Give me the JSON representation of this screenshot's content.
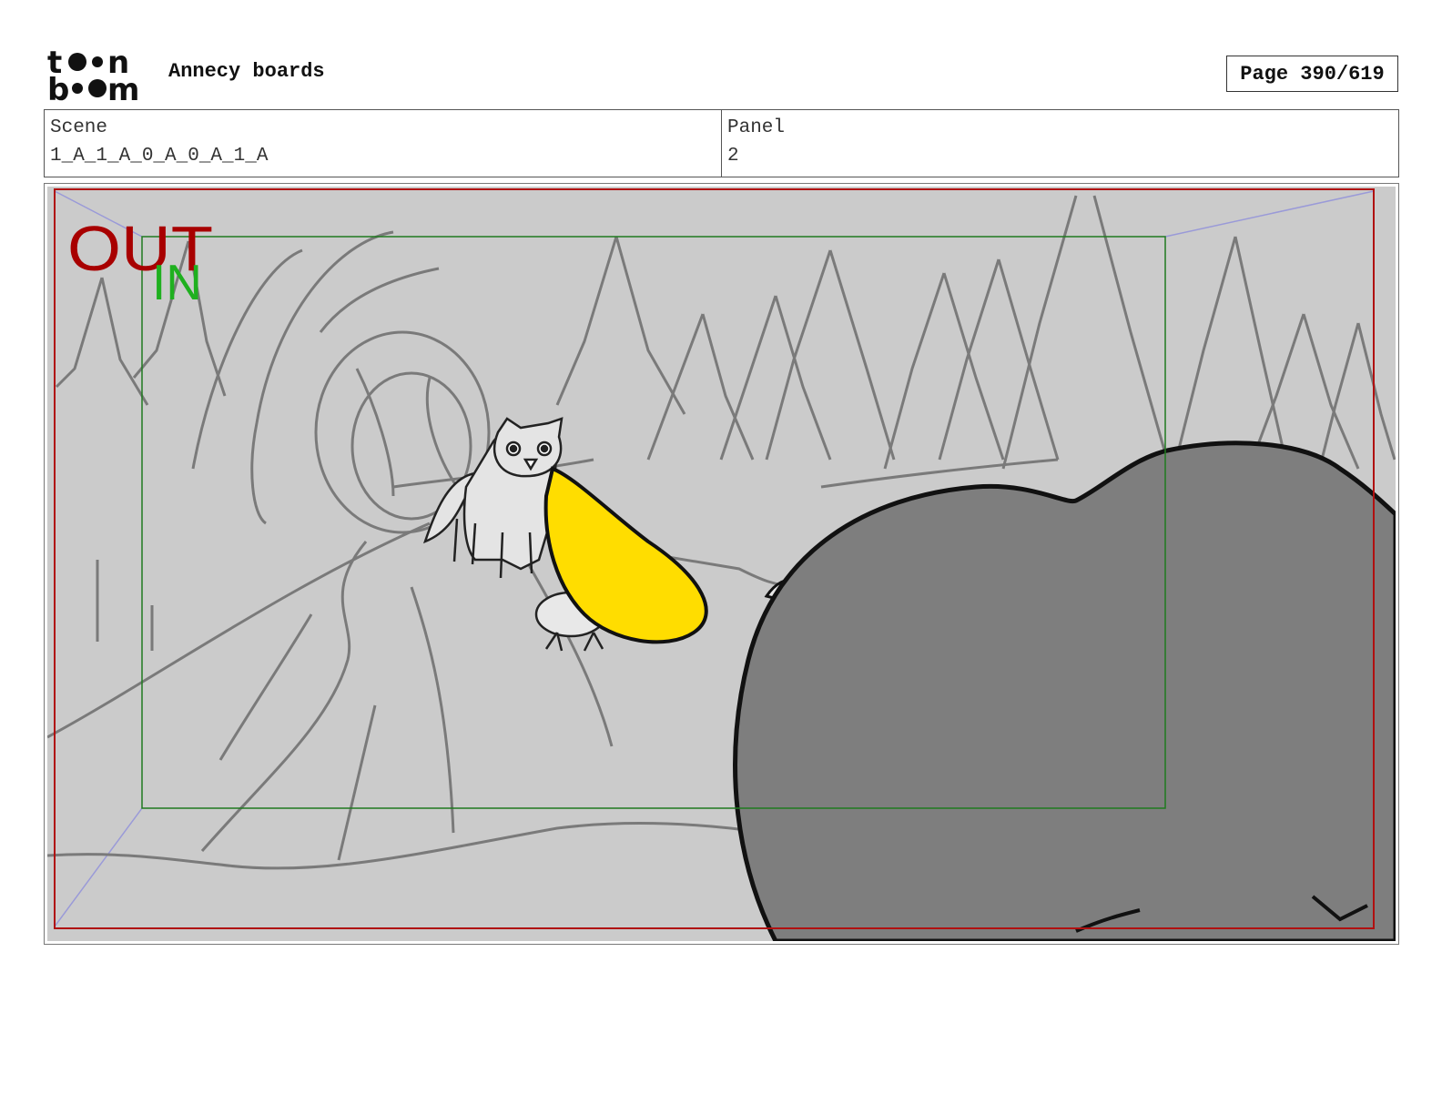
{
  "header": {
    "logo_text": "toon boom",
    "project_title": "Annecy boards",
    "page_label": "Page 390/619"
  },
  "info": {
    "scene_label": "Scene",
    "scene_value": "1_A_1_A_0_A_0_A_1_A",
    "panel_label": "Panel",
    "panel_value": "2"
  },
  "panel": {
    "out_label": "OUT",
    "in_label": "IN",
    "colors": {
      "background": "#cbcbcb",
      "sketch_lines": "#7a7a7a",
      "out_frame": "#b01010",
      "in_frame": "#1f7a1f",
      "out_text": "#a80000",
      "in_text": "#1fb01f",
      "yellow": "#ffdd00",
      "dark_character": "#7e7e7e",
      "guide_lines": "#9a9ad8"
    }
  }
}
